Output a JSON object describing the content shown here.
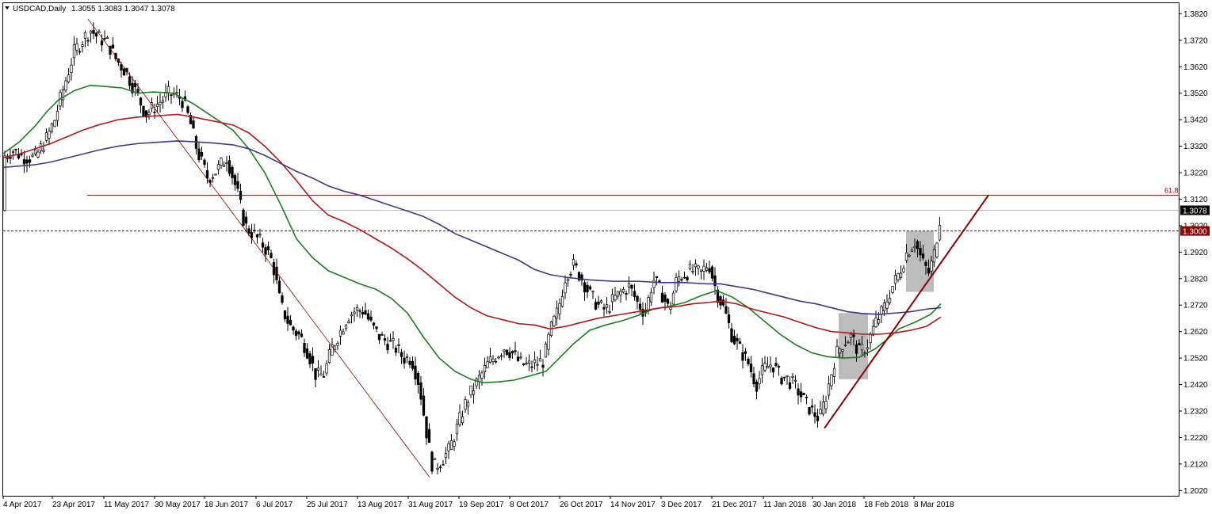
{
  "header": {
    "title": "USDCAD,Daily",
    "ohlc": "1.3055 1.3083 1.3047 1.3078"
  },
  "colors": {
    "bull_body": "#ffffff",
    "bear_body": "#000000",
    "candle_outline": "#000000",
    "ma_green": "#1a7f1a",
    "ma_red": "#b01919",
    "ma_blue": "#3a3a86",
    "fib_line": "#8b0000",
    "trend_line": "#8b0000",
    "grey_box": "#a0a0a0",
    "price_label_bg": "#000000",
    "level_label_bg": "#8b0000"
  },
  "chart_data": {
    "type": "candlestick",
    "title": "USDCAD,Daily",
    "ylim": [
      1.2,
      1.386
    ],
    "y_ticks": [
      "1.3820",
      "1.3720",
      "1.3620",
      "1.3520",
      "1.3420",
      "1.3320",
      "1.3220",
      "1.3120",
      "1.3020",
      "1.2920",
      "1.2820",
      "1.2720",
      "1.2620",
      "1.2520",
      "1.2420",
      "1.2320",
      "1.2220",
      "1.2120",
      "1.2020"
    ],
    "x_ticks": [
      "4 Apr 2017",
      "23 Apr 2017",
      "11 May 2017",
      "30 May 2017",
      "18 Jun 2017",
      "6 Jul 2017",
      "25 Jul 2017",
      "13 Aug 2017",
      "31 Aug 2017",
      "19 Sep 2017",
      "8 Oct 2017",
      "26 Oct 2017",
      "14 Nov 2017",
      "3 Dec 2017",
      "21 Dec 2017",
      "11 Jan 2018",
      "30 Jan 2018",
      "18 Feb 2018",
      "8 Mar 2018"
    ],
    "current_price": "1.3078",
    "level_price": "1.3000",
    "fib_label": "61.8",
    "fib_level": 1.3135,
    "series": [
      {
        "values": [
          [
            0,
            1.3292
          ],
          [
            20,
            1.3335
          ],
          [
            40,
            1.3395
          ],
          [
            55,
            1.345
          ],
          [
            70,
            1.3495
          ],
          [
            90,
            1.353
          ],
          [
            110,
            1.355
          ],
          [
            130,
            1.3545
          ],
          [
            150,
            1.354
          ],
          [
            170,
            1.352
          ],
          [
            190,
            1.3525
          ],
          [
            215,
            1.352
          ],
          [
            240,
            1.348
          ],
          [
            265,
            1.343
          ],
          [
            290,
            1.338
          ],
          [
            310,
            1.331
          ],
          [
            330,
            1.322
          ],
          [
            350,
            1.31
          ],
          [
            370,
            1.297
          ],
          [
            390,
            1.29
          ],
          [
            410,
            1.285
          ],
          [
            430,
            1.2825
          ],
          [
            450,
            1.28
          ],
          [
            470,
            1.278
          ],
          [
            490,
            1.2745
          ],
          [
            510,
            1.269
          ],
          [
            530,
            1.26
          ],
          [
            550,
            1.252
          ],
          [
            570,
            1.247
          ],
          [
            590,
            1.244
          ],
          [
            605,
            1.2427
          ],
          [
            625,
            1.243
          ],
          [
            645,
            1.2437
          ],
          [
            665,
            1.2453
          ],
          [
            685,
            1.247
          ],
          [
            700,
            1.2515
          ],
          [
            720,
            1.2575
          ],
          [
            740,
            1.2625
          ],
          [
            760,
            1.2645
          ],
          [
            780,
            1.266
          ],
          [
            800,
            1.268
          ],
          [
            820,
            1.2705
          ],
          [
            840,
            1.2715
          ],
          [
            860,
            1.273
          ],
          [
            880,
            1.2755
          ],
          [
            900,
            1.2775
          ],
          [
            920,
            1.275
          ],
          [
            940,
            1.271
          ],
          [
            960,
            1.266
          ],
          [
            980,
            1.261
          ],
          [
            1000,
            1.257
          ],
          [
            1020,
            1.254
          ],
          [
            1040,
            1.2525
          ],
          [
            1060,
            1.252
          ],
          [
            1080,
            1.2523
          ],
          [
            1100,
            1.2555
          ],
          [
            1115,
            1.259
          ],
          [
            1130,
            1.263
          ],
          [
            1150,
            1.2655
          ],
          [
            1170,
            1.2685
          ],
          [
            1183,
            1.2725
          ]
        ]
      },
      {
        "values": [
          [
            0,
            1.3277
          ],
          [
            20,
            1.329
          ],
          [
            40,
            1.331
          ],
          [
            60,
            1.333
          ],
          [
            80,
            1.3355
          ],
          [
            100,
            1.338
          ],
          [
            120,
            1.34
          ],
          [
            145,
            1.342
          ],
          [
            170,
            1.343
          ],
          [
            195,
            1.3435
          ],
          [
            220,
            1.344
          ],
          [
            240,
            1.343
          ],
          [
            265,
            1.3415
          ],
          [
            290,
            1.34
          ],
          [
            310,
            1.337
          ],
          [
            330,
            1.332
          ],
          [
            350,
            1.326
          ],
          [
            370,
            1.319
          ],
          [
            390,
            1.3115
          ],
          [
            410,
            1.306
          ],
          [
            430,
            1.3035
          ],
          [
            450,
            1.3005
          ],
          [
            470,
            1.297
          ],
          [
            490,
            1.2935
          ],
          [
            510,
            1.2895
          ],
          [
            530,
            1.285
          ],
          [
            550,
            1.28
          ],
          [
            570,
            1.275
          ],
          [
            590,
            1.271
          ],
          [
            610,
            1.268
          ],
          [
            630,
            1.2665
          ],
          [
            650,
            1.265
          ],
          [
            670,
            1.2645
          ],
          [
            690,
            1.263
          ],
          [
            710,
            1.264
          ],
          [
            730,
            1.2655
          ],
          [
            750,
            1.267
          ],
          [
            770,
            1.268
          ],
          [
            790,
            1.269
          ],
          [
            810,
            1.27
          ],
          [
            830,
            1.271
          ],
          [
            850,
            1.2715
          ],
          [
            870,
            1.2725
          ],
          [
            890,
            1.273
          ],
          [
            905,
            1.2735
          ],
          [
            925,
            1.2725
          ],
          [
            945,
            1.2705
          ],
          [
            965,
            1.269
          ],
          [
            985,
            1.2675
          ],
          [
            1005,
            1.2655
          ],
          [
            1025,
            1.2635
          ],
          [
            1045,
            1.262
          ],
          [
            1065,
            1.2615
          ],
          [
            1085,
            1.261
          ],
          [
            1105,
            1.261
          ],
          [
            1125,
            1.2615
          ],
          [
            1145,
            1.2625
          ],
          [
            1165,
            1.264
          ],
          [
            1183,
            1.2675
          ]
        ]
      },
      {
        "values": [
          [
            0,
            1.324
          ],
          [
            20,
            1.3245
          ],
          [
            40,
            1.325
          ],
          [
            60,
            1.326
          ],
          [
            80,
            1.3275
          ],
          [
            100,
            1.329
          ],
          [
            120,
            1.3305
          ],
          [
            145,
            1.332
          ],
          [
            170,
            1.333
          ],
          [
            195,
            1.3335
          ],
          [
            220,
            1.334
          ],
          [
            240,
            1.3337
          ],
          [
            265,
            1.3332
          ],
          [
            290,
            1.3325
          ],
          [
            310,
            1.331
          ],
          [
            330,
            1.3285
          ],
          [
            350,
            1.3255
          ],
          [
            370,
            1.3225
          ],
          [
            390,
            1.32
          ],
          [
            410,
            1.317
          ],
          [
            430,
            1.315
          ],
          [
            450,
            1.3135
          ],
          [
            470,
            1.3115
          ],
          [
            490,
            1.3095
          ],
          [
            510,
            1.3075
          ],
          [
            530,
            1.3055
          ],
          [
            550,
            1.3025
          ],
          [
            570,
            1.299
          ],
          [
            590,
            1.2965
          ],
          [
            610,
            1.294
          ],
          [
            630,
            1.2915
          ],
          [
            650,
            1.289
          ],
          [
            670,
            1.2855
          ],
          [
            690,
            1.2835
          ],
          [
            710,
            1.2825
          ],
          [
            740,
            1.2815
          ],
          [
            770,
            1.281
          ],
          [
            800,
            1.281
          ],
          [
            830,
            1.2805
          ],
          [
            860,
            1.2805
          ],
          [
            890,
            1.28
          ],
          [
            905,
            1.28
          ],
          [
            925,
            1.279
          ],
          [
            945,
            1.278
          ],
          [
            965,
            1.2765
          ],
          [
            985,
            1.275
          ],
          [
            1005,
            1.2735
          ],
          [
            1025,
            1.2725
          ],
          [
            1045,
            1.271
          ],
          [
            1065,
            1.2695
          ],
          [
            1085,
            1.2688
          ],
          [
            1105,
            1.2685
          ],
          [
            1125,
            1.269
          ],
          [
            1145,
            1.2695
          ],
          [
            1165,
            1.2705
          ],
          [
            1183,
            1.271
          ]
        ]
      }
    ],
    "candles_shape": [
      [
        0,
        1.328
      ],
      [
        12,
        1.3305
      ],
      [
        25,
        1.328
      ],
      [
        40,
        1.3275
      ],
      [
        55,
        1.335
      ],
      [
        65,
        1.342
      ],
      [
        78,
        1.356
      ],
      [
        90,
        1.368
      ],
      [
        100,
        1.372
      ],
      [
        110,
        1.376
      ],
      [
        120,
        1.373
      ],
      [
        132,
        1.371
      ],
      [
        142,
        1.365
      ],
      [
        155,
        1.36
      ],
      [
        168,
        1.352
      ],
      [
        180,
        1.344
      ],
      [
        195,
        1.348
      ],
      [
        210,
        1.352
      ],
      [
        225,
        1.35
      ],
      [
        235,
        1.342
      ],
      [
        245,
        1.33
      ],
      [
        258,
        1.32
      ],
      [
        270,
        1.323
      ],
      [
        282,
        1.328
      ],
      [
        295,
        1.315
      ],
      [
        305,
        1.302
      ],
      [
        318,
        1.298
      ],
      [
        330,
        1.294
      ],
      [
        340,
        1.288
      ],
      [
        350,
        1.272
      ],
      [
        362,
        1.264
      ],
      [
        375,
        1.26
      ],
      [
        385,
        1.254
      ],
      [
        395,
        1.245
      ],
      [
        405,
        1.246
      ],
      [
        415,
        1.256
      ],
      [
        425,
        1.262
      ],
      [
        435,
        1.268
      ],
      [
        445,
        1.27
      ],
      [
        455,
        1.27
      ],
      [
        465,
        1.264
      ],
      [
        475,
        1.26
      ],
      [
        485,
        1.258
      ],
      [
        495,
        1.256
      ],
      [
        505,
        1.252
      ],
      [
        515,
        1.252
      ],
      [
        525,
        1.242
      ],
      [
        535,
        1.222
      ],
      [
        542,
        1.2105
      ],
      [
        552,
        1.213
      ],
      [
        562,
        1.217
      ],
      [
        572,
        1.225
      ],
      [
        582,
        1.234
      ],
      [
        592,
        1.24
      ],
      [
        602,
        1.245
      ],
      [
        612,
        1.25
      ],
      [
        622,
        1.253
      ],
      [
        632,
        1.256
      ],
      [
        642,
        1.254
      ],
      [
        652,
        1.25
      ],
      [
        662,
        1.249
      ],
      [
        672,
        1.25
      ],
      [
        682,
        1.251
      ],
      [
        690,
        1.262
      ],
      [
        700,
        1.27
      ],
      [
        710,
        1.284
      ],
      [
        720,
        1.287
      ],
      [
        730,
        1.282
      ],
      [
        740,
        1.276
      ],
      [
        750,
        1.272
      ],
      [
        760,
        1.27
      ],
      [
        770,
        1.274
      ],
      [
        780,
        1.277
      ],
      [
        790,
        1.279
      ],
      [
        800,
        1.273
      ],
      [
        810,
        1.269
      ],
      [
        820,
        1.282
      ],
      [
        830,
        1.277
      ],
      [
        840,
        1.27
      ],
      [
        850,
        1.282
      ],
      [
        860,
        1.284
      ],
      [
        870,
        1.285
      ],
      [
        880,
        1.284
      ],
      [
        890,
        1.288
      ],
      [
        900,
        1.277
      ],
      [
        910,
        1.27
      ],
      [
        920,
        1.26
      ],
      [
        930,
        1.255
      ],
      [
        940,
        1.25
      ],
      [
        950,
        1.242
      ],
      [
        960,
        1.248
      ],
      [
        970,
        1.25
      ],
      [
        980,
        1.245
      ],
      [
        990,
        1.244
      ],
      [
        1000,
        1.241
      ],
      [
        1010,
        1.236
      ],
      [
        1020,
        1.232
      ],
      [
        1030,
        1.229
      ],
      [
        1040,
        1.24
      ],
      [
        1050,
        1.253
      ],
      [
        1060,
        1.258
      ],
      [
        1070,
        1.26
      ],
      [
        1080,
        1.254
      ],
      [
        1090,
        1.257
      ],
      [
        1100,
        1.265
      ],
      [
        1110,
        1.27
      ],
      [
        1120,
        1.278
      ],
      [
        1130,
        1.284
      ],
      [
        1140,
        1.292
      ],
      [
        1150,
        1.296
      ],
      [
        1160,
        1.288
      ],
      [
        1168,
        1.284
      ],
      [
        1175,
        1.292
      ],
      [
        1183,
        1.3078
      ]
    ]
  }
}
